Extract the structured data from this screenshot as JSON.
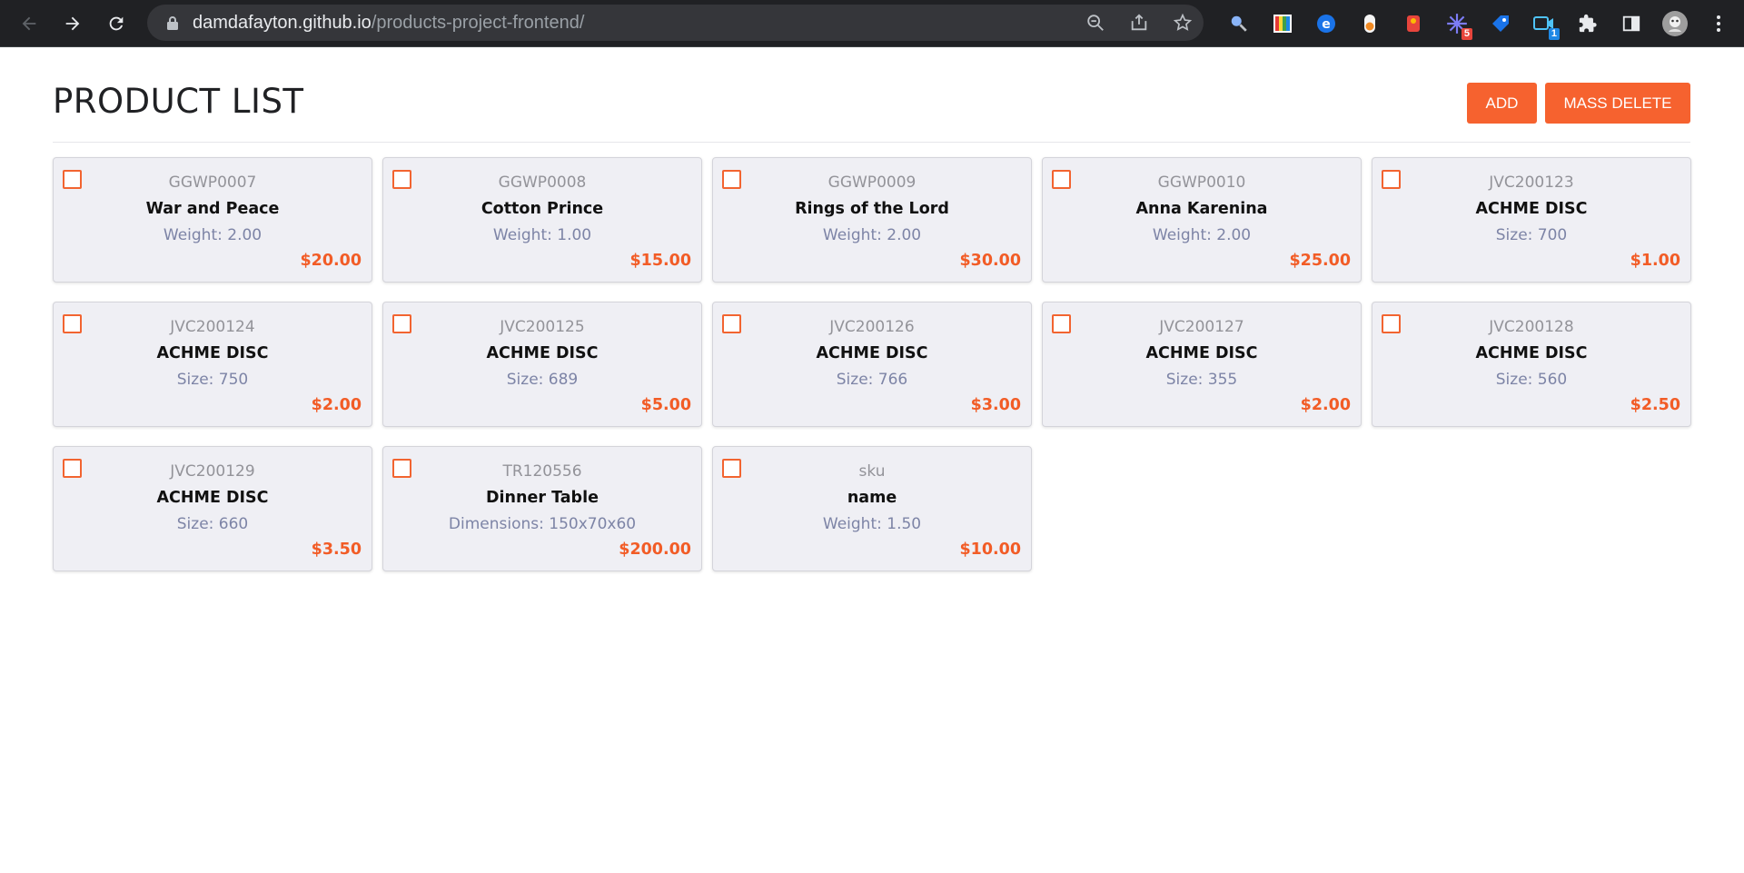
{
  "browser": {
    "url_host": "damdafayton.github.io",
    "url_path": "/products-project-frontend/",
    "extension_badges": {
      "ext6": "5",
      "ext8": "1"
    },
    "icons": [
      "back-icon",
      "forward-icon",
      "reload-icon",
      "lock-icon",
      "zoom-icon",
      "share-icon",
      "star-icon",
      "magnifier-ext-icon",
      "color-picker-ext-icon",
      "e-ext-icon",
      "toggle-ext-icon",
      "badge-ext-icon",
      "spark-ext-icon",
      "tag-ext-icon",
      "video-ext-icon",
      "puzzle-icon",
      "side-panel-icon",
      "profile-avatar",
      "more-icon"
    ]
  },
  "header": {
    "title": "PRODUCT LIST",
    "add_label": "ADD",
    "mass_delete_label": "MASS DELETE"
  },
  "colors": {
    "accent": "#f6622f",
    "price": "#f25c26",
    "card_bg": "#efeff4",
    "attr_text": "#7d84a6"
  },
  "products": [
    {
      "sku": "GGWP0007",
      "name": "War and Peace",
      "attr": "Weight: 2.00",
      "price": "$20.00"
    },
    {
      "sku": "GGWP0008",
      "name": "Cotton Prince",
      "attr": "Weight: 1.00",
      "price": "$15.00"
    },
    {
      "sku": "GGWP0009",
      "name": "Rings of the Lord",
      "attr": "Weight: 2.00",
      "price": "$30.00"
    },
    {
      "sku": "GGWP0010",
      "name": "Anna Karenina",
      "attr": "Weight: 2.00",
      "price": "$25.00"
    },
    {
      "sku": "JVC200123",
      "name": "ACHME DISC",
      "attr": "Size: 700",
      "price": "$1.00"
    },
    {
      "sku": "JVC200124",
      "name": "ACHME DISC",
      "attr": "Size: 750",
      "price": "$2.00"
    },
    {
      "sku": "JVC200125",
      "name": "ACHME DISC",
      "attr": "Size: 689",
      "price": "$5.00"
    },
    {
      "sku": "JVC200126",
      "name": "ACHME DISC",
      "attr": "Size: 766",
      "price": "$3.00"
    },
    {
      "sku": "JVC200127",
      "name": "ACHME DISC",
      "attr": "Size: 355",
      "price": "$2.00"
    },
    {
      "sku": "JVC200128",
      "name": "ACHME DISC",
      "attr": "Size: 560",
      "price": "$2.50"
    },
    {
      "sku": "JVC200129",
      "name": "ACHME DISC",
      "attr": "Size: 660",
      "price": "$3.50"
    },
    {
      "sku": "TR120556",
      "name": "Dinner Table",
      "attr": "Dimensions: 150x70x60",
      "price": "$200.00"
    },
    {
      "sku": "sku",
      "name": "name",
      "attr": "Weight: 1.50",
      "price": "$10.00"
    }
  ]
}
